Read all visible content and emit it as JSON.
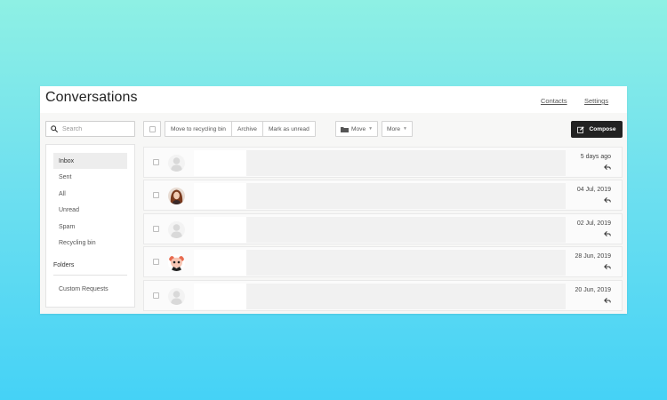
{
  "header": {
    "title": "Conversations",
    "contacts_link": "Contacts",
    "settings_link": "Settings"
  },
  "search": {
    "placeholder": "Search",
    "value": ""
  },
  "sidebar": {
    "items": [
      {
        "label": "Inbox",
        "active": true
      },
      {
        "label": "Sent"
      },
      {
        "label": "All"
      },
      {
        "label": "Unread"
      },
      {
        "label": "Spam"
      },
      {
        "label": "Recycling bin"
      }
    ],
    "folders_label": "Folders",
    "folders": [
      {
        "label": "Custom Requests"
      }
    ]
  },
  "toolbar": {
    "recycle_label": "Move to recycling bin",
    "archive_label": "Archive",
    "mark_unread_label": "Mark as unread",
    "move_label": "Move",
    "more_label": "More",
    "compose_label": "Compose"
  },
  "conversations": [
    {
      "date": "5 days ago",
      "avatar": "default-avatar"
    },
    {
      "date": "04 Jul, 2019",
      "avatar": "woman-photo-avatar"
    },
    {
      "date": "02 Jul, 2019",
      "avatar": "default-avatar"
    },
    {
      "date": "28 Jun, 2019",
      "avatar": "panda-avatar"
    },
    {
      "date": "20 Jun, 2019",
      "avatar": "default-avatar"
    }
  ],
  "colors": {
    "compose_bg": "#222222",
    "active_item_bg": "#ededed",
    "background_gradient_top": "#8ef0e4",
    "background_gradient_bottom": "#45d2f6"
  },
  "icons": {
    "search": "search-icon",
    "compose": "edit-icon",
    "move": "folder-icon",
    "reply": "reply-arrow-icon"
  }
}
